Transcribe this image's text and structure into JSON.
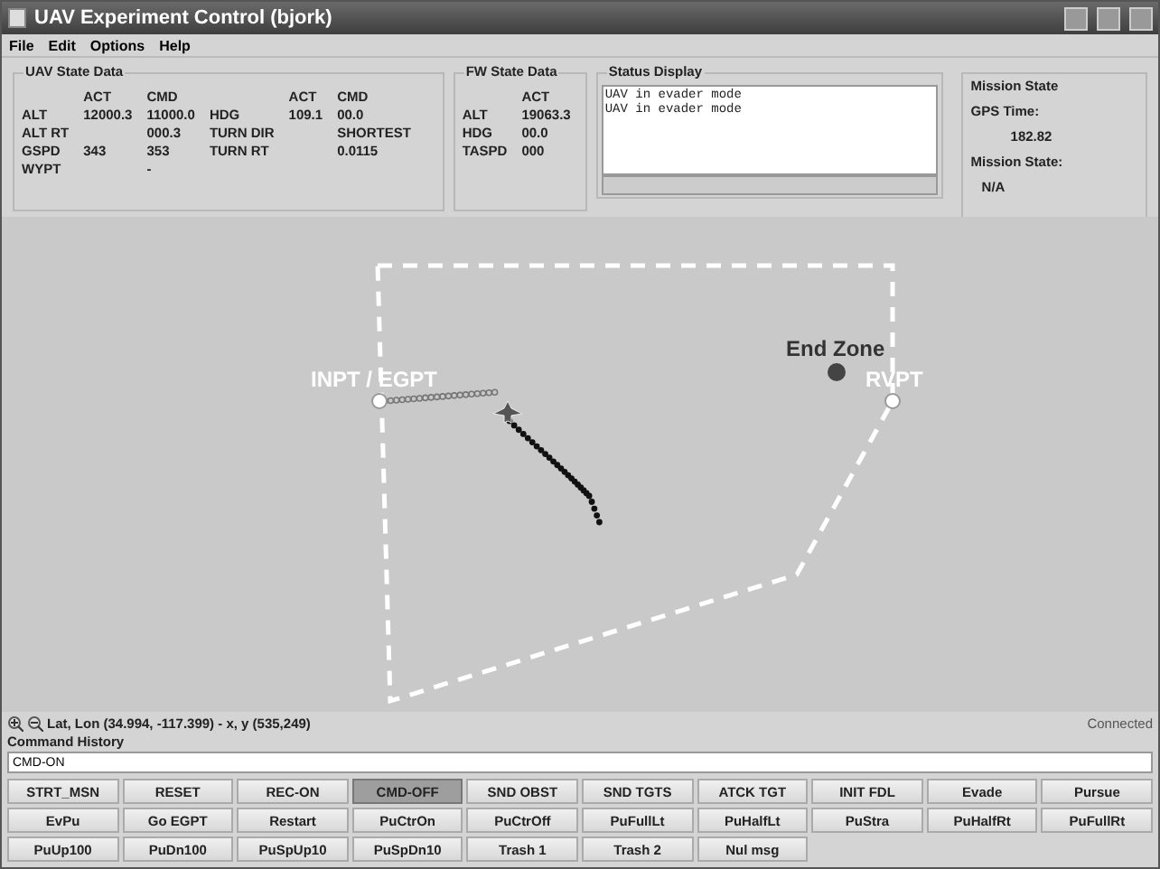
{
  "window": {
    "title": "UAV Experiment Control (bjork)"
  },
  "menu": [
    "File",
    "Edit",
    "Options",
    "Help"
  ],
  "uav_state": {
    "title": "UAV State Data",
    "blocks": [
      {
        "header": [
          "ACT",
          "CMD"
        ],
        "rows": [
          {
            "label": "ALT",
            "act": "12000.3",
            "cmd": "11000.0"
          },
          {
            "label": "ALT RT",
            "cmd": "000.3"
          },
          {
            "label": "GSPD",
            "act": "343",
            "cmd": "353"
          },
          {
            "label": "WYPT",
            "cmd": "-"
          }
        ]
      },
      {
        "header": [
          "ACT",
          "CMD"
        ],
        "rows": [
          {
            "label": "HDG",
            "act": "109.1",
            "cmd": "00.0"
          },
          {
            "label": "TURN DIR",
            "cmd": "SHORTEST"
          },
          {
            "label": "TURN RT",
            "cmd": "0.0115"
          }
        ]
      }
    ]
  },
  "fw_state": {
    "title": "FW State Data",
    "blocks": [
      {
        "header": [
          "ACT"
        ],
        "rows": [
          {
            "label": "ALT",
            "act": "19063.3"
          },
          {
            "label": "HDG",
            "act": "00.0"
          },
          {
            "label": "TASPD",
            "act": "000"
          }
        ]
      }
    ]
  },
  "status_display": {
    "title": "Status Display",
    "lines": [
      "UAV in evader mode",
      "UAV in evader mode"
    ]
  },
  "mission_state": {
    "title": "Mission State",
    "gps_label": "GPS Time:",
    "gps_time": "182.82",
    "state_label": "Mission State:",
    "state": "N/A"
  },
  "map": {
    "waypoints": [
      {
        "label": "INPT / EGPT"
      },
      {
        "label": "RVPT"
      }
    ],
    "end_zone": {
      "label": "End Zone"
    }
  },
  "footer": {
    "position": "Lat, Lon (34.994, -117.399) - x, y (535,249)",
    "connection": "Connected"
  },
  "command_history": {
    "label": "Command History",
    "value": "CMD-ON"
  },
  "buttons": [
    {
      "label": "STRT_MSN",
      "selected": false
    },
    {
      "label": "RESET",
      "selected": false
    },
    {
      "label": "REC-ON",
      "selected": false
    },
    {
      "label": "CMD-OFF",
      "selected": true
    },
    {
      "label": "SND OBST",
      "selected": false
    },
    {
      "label": "SND TGTS",
      "selected": false
    },
    {
      "label": "ATCK TGT",
      "selected": false
    },
    {
      "label": "INIT FDL",
      "selected": false
    },
    {
      "label": "Evade",
      "selected": false
    },
    {
      "label": "Pursue",
      "selected": false
    },
    {
      "label": "EvPu",
      "selected": false
    },
    {
      "label": "Go EGPT",
      "selected": false
    },
    {
      "label": "Restart",
      "selected": false
    },
    {
      "label": "PuCtrOn",
      "selected": false
    },
    {
      "label": "PuCtrOff",
      "selected": false
    },
    {
      "label": "PuFullLt",
      "selected": false
    },
    {
      "label": "PuHalfLt",
      "selected": false
    },
    {
      "label": "PuStra",
      "selected": false
    },
    {
      "label": "PuHalfRt",
      "selected": false
    },
    {
      "label": "PuFullRt",
      "selected": false
    },
    {
      "label": "PuUp100",
      "selected": false
    },
    {
      "label": "PuDn100",
      "selected": false
    },
    {
      "label": "PuSpUp10",
      "selected": false
    },
    {
      "label": "PuSpDn10",
      "selected": false
    },
    {
      "label": "Trash 1",
      "selected": false
    },
    {
      "label": "Trash 2",
      "selected": false
    },
    {
      "label": "Nul msg",
      "selected": false
    }
  ]
}
